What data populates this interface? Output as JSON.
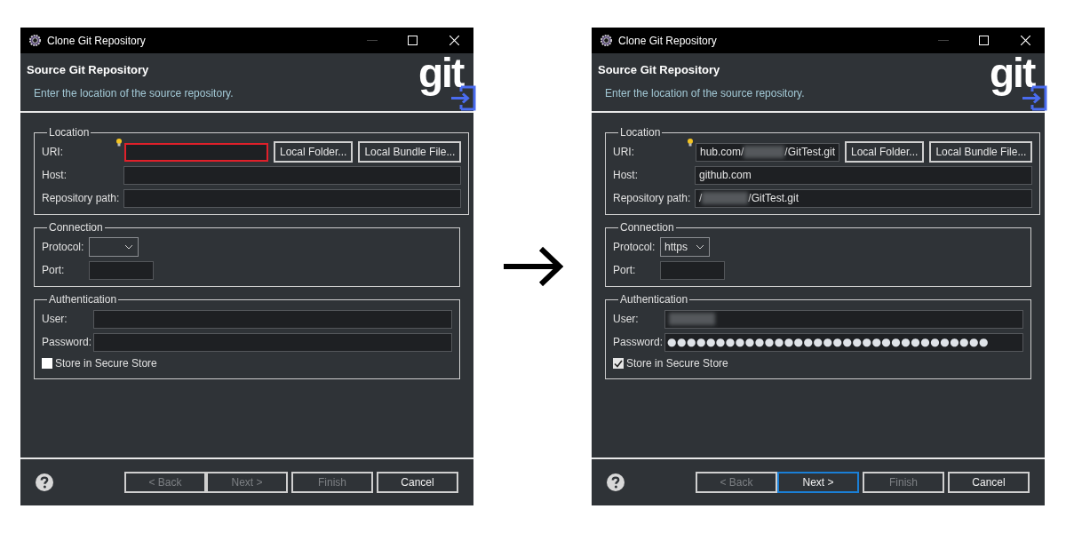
{
  "dialogs": [
    {
      "window": {
        "title": "Clone Git Repository"
      },
      "header": {
        "title": "Source Git Repository",
        "description": "Enter the location of the source repository.",
        "logo_text": "git"
      },
      "location": {
        "legend": "Location",
        "uri": {
          "label": "URI:",
          "error": true
        },
        "host": {
          "label": "Host:"
        },
        "path": {
          "label": "Repository path:"
        },
        "buttons": [
          "Local Folder...",
          "Local Bundle File..."
        ]
      },
      "connection": {
        "legend": "Connection",
        "protocol": {
          "label": "Protocol:"
        },
        "port": {
          "label": "Port:"
        }
      },
      "authentication": {
        "legend": "Authentication",
        "user": {
          "label": "User:"
        },
        "password": {
          "label": "Password:"
        },
        "store": {
          "label": "Store in Secure Store",
          "checked": false
        }
      },
      "buttons": [
        {
          "label": "< Back",
          "disabled": true,
          "focused": false
        },
        {
          "label": "Next >",
          "disabled": true,
          "focused": false
        },
        {
          "label": "Finish",
          "disabled": true,
          "focused": false
        },
        {
          "label": "Cancel",
          "disabled": false,
          "focused": false
        }
      ]
    },
    {
      "window": {
        "title": "Clone Git Repository"
      },
      "header": {
        "title": "Source Git Repository",
        "description": "Enter the location of the source repository.",
        "logo_text": "git"
      },
      "location": {
        "legend": "Location",
        "uri": {
          "label": "URI:",
          "error": false,
          "value_parts": [
            {
              "kind": "text",
              "text": "hub.com/"
            },
            {
              "kind": "redacted"
            },
            {
              "kind": "text",
              "text": "/GitTest.git"
            }
          ]
        },
        "host": {
          "label": "Host:",
          "value_parts": [
            {
              "kind": "text",
              "text": "github.com"
            }
          ]
        },
        "path": {
          "label": "Repository path:",
          "value_parts": [
            {
              "kind": "text",
              "text": "/"
            },
            {
              "kind": "redacted"
            },
            {
              "kind": "text",
              "text": "/GitTest.git"
            }
          ]
        },
        "buttons": [
          "Local Folder...",
          "Local Bundle File..."
        ]
      },
      "connection": {
        "legend": "Connection",
        "protocol": {
          "label": "Protocol:",
          "value": "https"
        },
        "port": {
          "label": "Port:"
        }
      },
      "authentication": {
        "legend": "Authentication",
        "user": {
          "label": "User:",
          "value_parts": [
            {
              "kind": "redacted"
            }
          ]
        },
        "password": {
          "label": "Password:",
          "value": "●●●●●●●●●●●●●●●●●●●●●●●●●●●●●●●●●"
        },
        "store": {
          "label": "Store in Secure Store",
          "checked": true
        }
      },
      "buttons": [
        {
          "label": "< Back",
          "disabled": true,
          "focused": false
        },
        {
          "label": "Next >",
          "disabled": false,
          "focused": true
        },
        {
          "label": "Finish",
          "disabled": true,
          "focused": false
        },
        {
          "label": "Cancel",
          "disabled": false,
          "focused": false
        }
      ]
    }
  ]
}
